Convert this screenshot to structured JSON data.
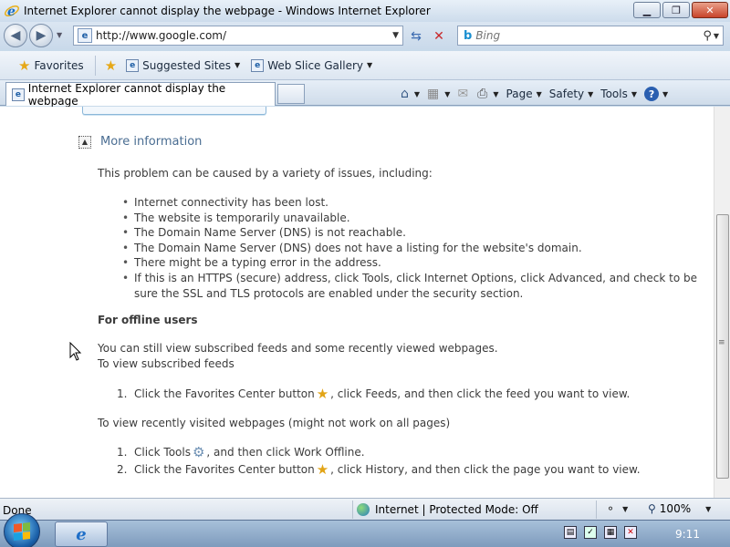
{
  "window": {
    "title": "Internet Explorer cannot display the webpage - Windows Internet Explorer",
    "minimize_icon": "minimize-icon",
    "maximize_icon": "maximize-icon",
    "close_icon": "close-icon"
  },
  "addressbar": {
    "url": "http://www.google.com/",
    "search_placeholder": "Bing"
  },
  "favorites": {
    "favorites_label": "Favorites",
    "suggested_sites": "Suggested Sites",
    "web_slice_gallery": "Web Slice Gallery"
  },
  "tab": {
    "label": "Internet Explorer cannot display the webpage"
  },
  "commandbar": {
    "page": "Page",
    "safety": "Safety",
    "tools": "Tools"
  },
  "content": {
    "more_info": "More information",
    "intro": "This problem can be caused by a variety of issues, including:",
    "issues": [
      "Internet connectivity has been lost.",
      "The website is temporarily unavailable.",
      "The Domain Name Server (DNS) is not reachable.",
      "The Domain Name Server (DNS) does not have a listing for the website's domain.",
      "There might be a typing error in the address.",
      "If this is an HTTPS (secure) address, click Tools, click Internet Options, click Advanced, and check to be sure the SSL and TLS protocols are enabled under the security section."
    ],
    "offline_heading": "For offline users",
    "offline_line1": "You can still view subscribed feeds and some recently viewed webpages.",
    "offline_line2": "To view subscribed feeds",
    "feeds_step_num": "1.",
    "feeds_step_a": "Click the Favorites Center button",
    "feeds_step_b": ", click Feeds, and then click the feed you want to view.",
    "recent_heading": "To view recently visited webpages (might not work on all pages)",
    "recent_step1_num": "1.",
    "recent_step1_a": "Click Tools",
    "recent_step1_b": ", and then click Work Offline.",
    "recent_step2_num": "2.",
    "recent_step2_a": "Click the Favorites Center button",
    "recent_step2_b": ", click History, and then click the page you want to view."
  },
  "statusbar": {
    "status": "Done",
    "zone": "Internet | Protected Mode: Off",
    "zoom": "100%"
  },
  "taskbar": {
    "clock": "9:11"
  }
}
